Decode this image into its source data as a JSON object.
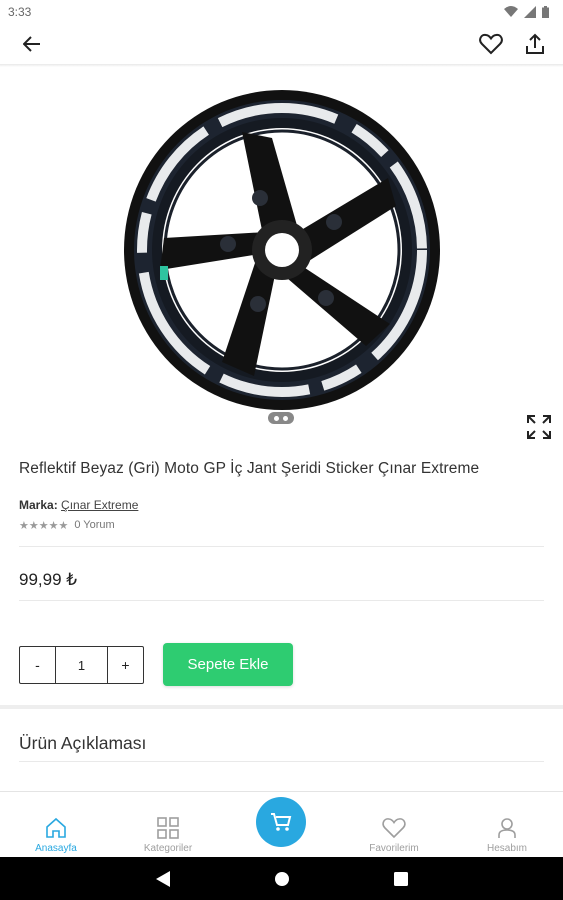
{
  "status_bar": {
    "time": "3:33",
    "icons": [
      "wifi-icon",
      "signal-icon",
      "battery-icon"
    ]
  },
  "app_bar": {
    "back_icon": "arrow-left-icon",
    "favorite_icon": "heart-outline-icon",
    "share_icon": "share-icon"
  },
  "product": {
    "image": "black motorcycle wheel with reflective white rim stripe",
    "title": "Reflektif Beyaz (Gri) Moto GP İç Jant Şeridi Sticker Çınar Extreme",
    "brand_label": "Marka:",
    "brand_name": "Çınar Extreme",
    "stars": "★★★★★",
    "reviews": "0 Yorum",
    "price": "99,99 ₺",
    "quantity": "1",
    "minus_label": "-",
    "plus_label": "+",
    "add_to_cart_label": "Sepete Ekle",
    "description_title": "Ürün Açıklaması"
  },
  "bottom_nav": {
    "items": [
      {
        "label": "Anasayfa",
        "icon": "home-icon",
        "active": true
      },
      {
        "label": "Kategoriler",
        "icon": "grid-icon",
        "active": false
      },
      {
        "label": "",
        "icon": "cart-icon",
        "active": false
      },
      {
        "label": "Favorilerim",
        "icon": "heart-icon",
        "active": false
      },
      {
        "label": "Hesabım",
        "icon": "user-icon",
        "active": false
      }
    ]
  },
  "colors": {
    "accent": "#29a8e0",
    "button_green": "#2ecc71"
  }
}
